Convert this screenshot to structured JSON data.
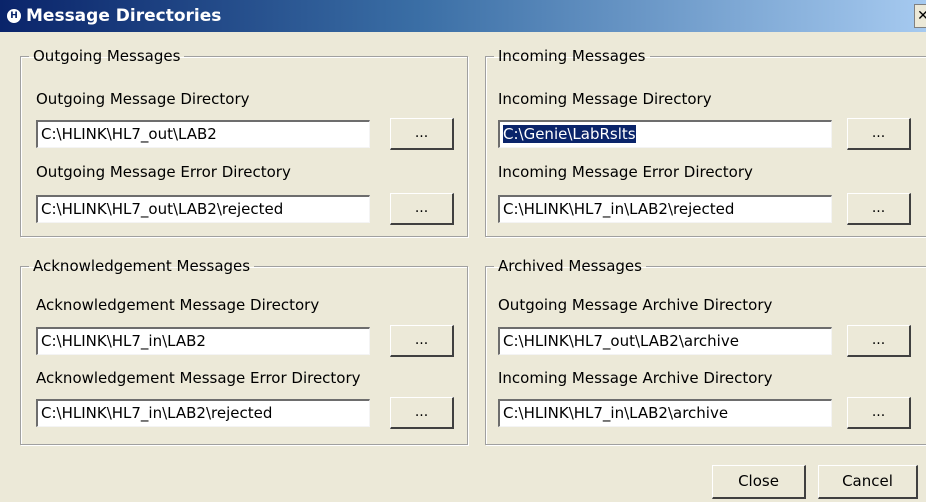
{
  "window": {
    "title": "Message Directories",
    "icon": "app-logo-icon"
  },
  "outgoing": {
    "legend": "Outgoing Messages",
    "dir_label": "Outgoing Message Directory",
    "dir_value": "C:\\HLINK\\HL7_out\\LAB2",
    "err_label": "Outgoing Message Error Directory",
    "err_value": "C:\\HLINK\\HL7_out\\LAB2\\rejected"
  },
  "incoming": {
    "legend": "Incoming Messages",
    "dir_label": "Incoming Message Directory",
    "dir_value": "C:\\Genie\\LabRslts",
    "err_label": "Incoming Message Error Directory",
    "err_value": "C:\\HLINK\\HL7_in\\LAB2\\rejected"
  },
  "ack": {
    "legend": "Acknowledgement Messages",
    "dir_label": "Acknowledgement Message Directory",
    "dir_value": "C:\\HLINK\\HL7_in\\LAB2",
    "err_label": "Acknowledgement Message Error Directory",
    "err_value": "C:\\HLINK\\HL7_in\\LAB2\\rejected"
  },
  "archived": {
    "legend": "Archived Messages",
    "out_label": "Outgoing Message Archive Directory",
    "out_value": "C:\\HLINK\\HL7_out\\LAB2\\archive",
    "in_label": "Incoming Message Archive Directory",
    "in_value": "C:\\HLINK\\HL7_in\\LAB2\\archive"
  },
  "browse_label": "...",
  "buttons": {
    "close": "Close",
    "cancel": "Cancel"
  },
  "colors": {
    "selection": "#0a246a",
    "dialog_bg": "#ece9d8"
  }
}
